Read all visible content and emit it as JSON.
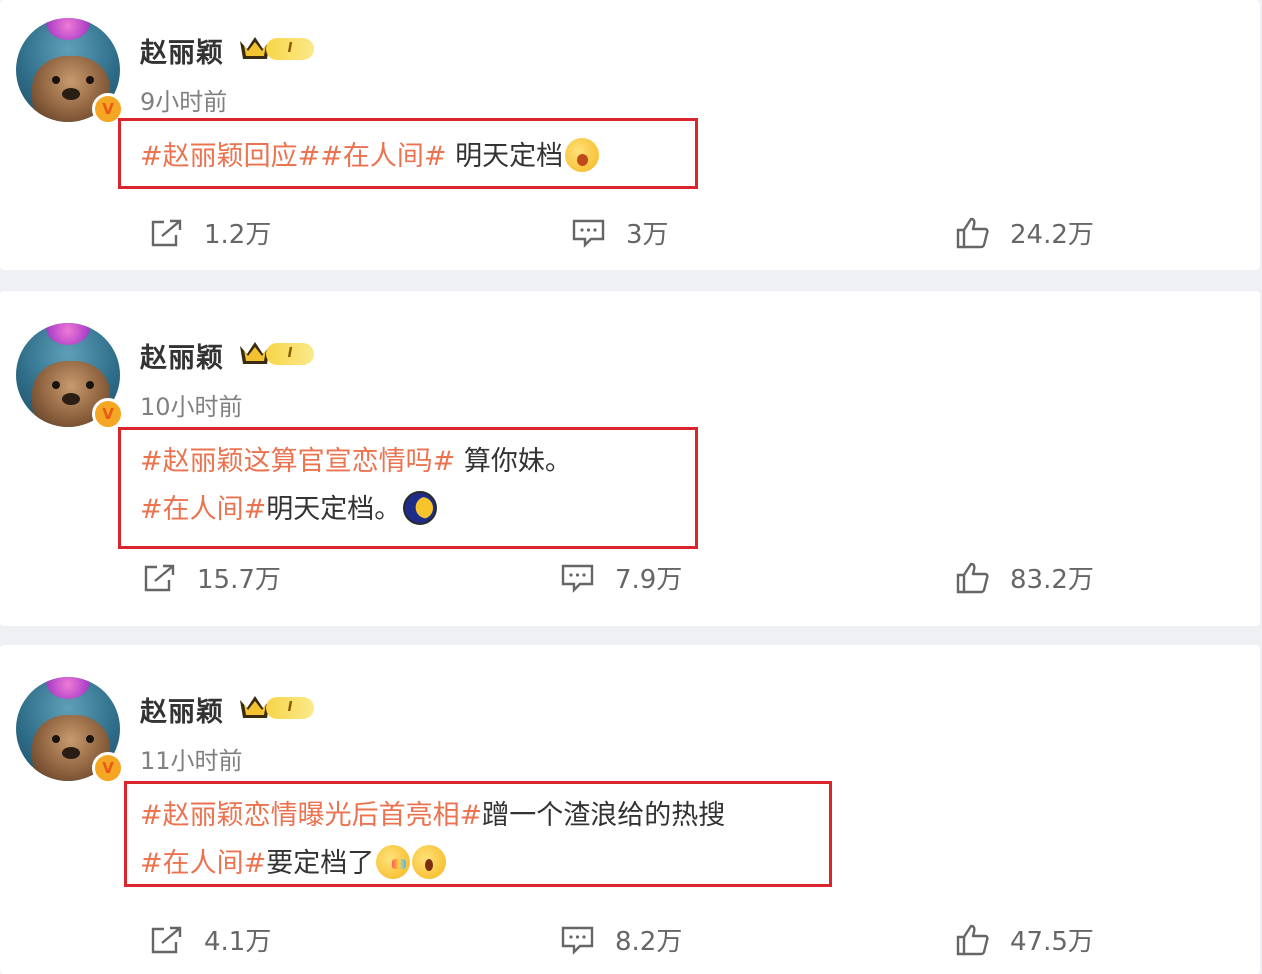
{
  "accent_color": "#eb7350",
  "highlight_box_color": "#d9252c",
  "posts": [
    {
      "author": "赵丽颖",
      "level_badge": "I",
      "time": "9小时前",
      "lines": [
        {
          "tags": "#赵丽颖回应##在人间#",
          "text": " 明天定档",
          "emojis": [
            "sob-emoji"
          ]
        }
      ],
      "share": "1.2万",
      "comments": "3万",
      "likes": "24.2万"
    },
    {
      "author": "赵丽颖",
      "level_badge": "I",
      "time": "10小时前",
      "lines": [
        {
          "tags": "#赵丽颖这算官宣恋情吗#",
          "text": " 算你妹。"
        },
        {
          "tags": "#在人间#",
          "text": "明天定档。",
          "emojis": [
            "moon-emoji"
          ]
        }
      ],
      "share": "15.7万",
      "comments": "7.9万",
      "likes": "83.2万"
    },
    {
      "author": "赵丽颖",
      "level_badge": "I",
      "time": "11小时前",
      "lines": [
        {
          "tags": "#赵丽颖恋情曝光后首亮相#",
          "text": "蹭一个渣浪给的热搜"
        },
        {
          "tags": "#在人间#",
          "text": "要定档了",
          "emojis": [
            "tongue-emoji",
            "scream-emoji"
          ]
        }
      ],
      "share": "4.1万",
      "comments": "8.2万",
      "likes": "47.5万"
    }
  ]
}
